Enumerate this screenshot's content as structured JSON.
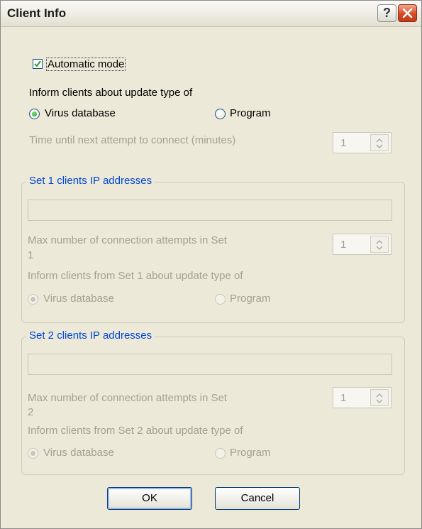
{
  "window": {
    "title": "Client Info"
  },
  "automatic_mode": {
    "label": "Automatic mode",
    "checked": true
  },
  "update_type": {
    "heading": "Inform clients about update type of",
    "options": [
      "Virus database",
      "Program"
    ],
    "selected": "Virus database"
  },
  "reconnect": {
    "label": "Time until next attempt to connect (minutes)",
    "value": "1"
  },
  "set1": {
    "legend": "Set 1 clients IP addresses",
    "ip_value": "",
    "attempts_label_line1": "Max number of connection attempts in Set",
    "attempts_label_line2": "1",
    "attempts_value": "1",
    "inform_label": "Inform clients from Set 1 about update type of",
    "options": [
      "Virus database",
      "Program"
    ],
    "selected": "Virus database"
  },
  "set2": {
    "legend": "Set 2 clients IP addresses",
    "ip_value": "",
    "attempts_label_line1": "Max number of connection attempts in Set",
    "attempts_label_line2": "2",
    "attempts_value": "1",
    "inform_label": "Inform clients from Set 2 about update type of",
    "options": [
      "Virus database",
      "Program"
    ],
    "selected": "Virus database"
  },
  "buttons": {
    "ok": "OK",
    "cancel": "Cancel"
  },
  "icons": [
    "help-icon",
    "close-icon",
    "checkmark-icon",
    "spin-up-icon",
    "spin-down-icon"
  ],
  "colors": {
    "group_legend": "#0046d5",
    "disabled_text": "#a4a194",
    "checkmark": "#21a121"
  }
}
